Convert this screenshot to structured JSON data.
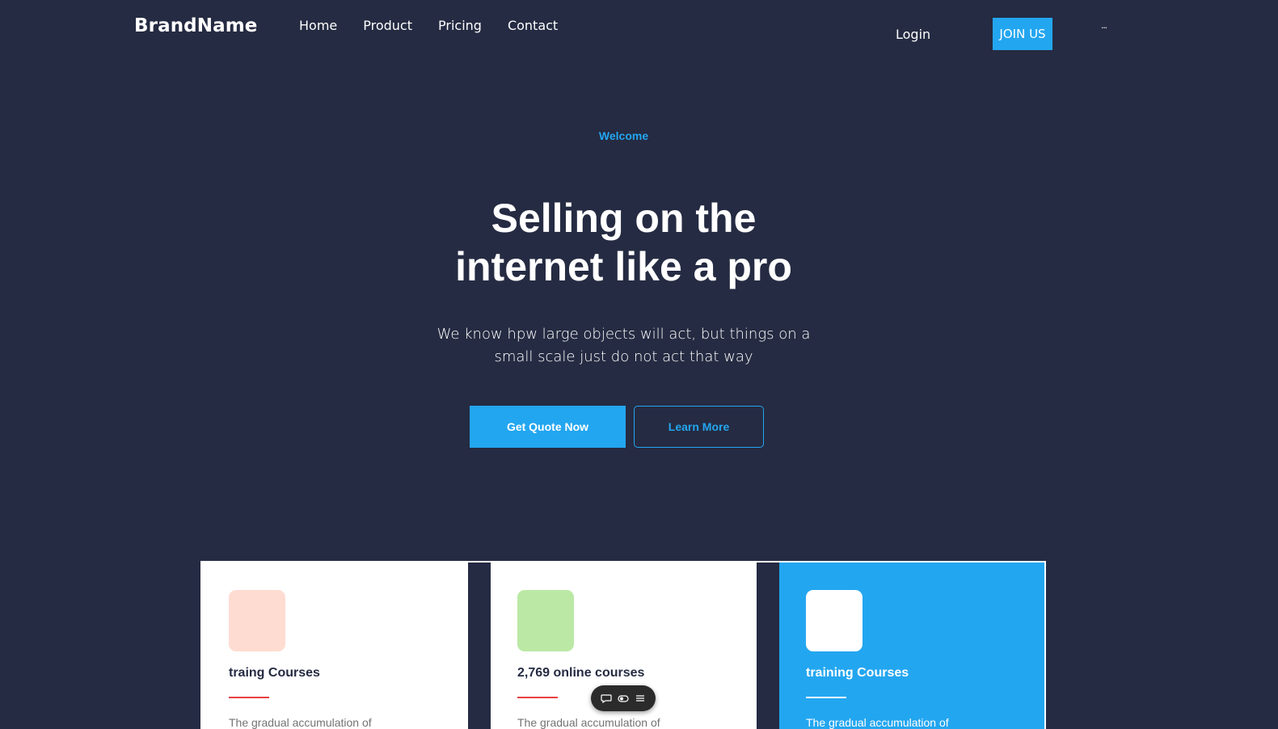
{
  "nav": {
    "brand": "BrandName",
    "links": [
      "Home",
      "Product",
      "Pricing",
      "Contact"
    ],
    "login": "Login",
    "join": "JOIN US",
    "more": "..."
  },
  "hero": {
    "welcome": "Welcome",
    "title_lines": [
      "Selling on the",
      "internet like a pro"
    ],
    "desc_lines": [
      "We know hpw large objects will act, but things on a",
      "small scale just do not act that way"
    ],
    "primary_button": "Get Quote Now",
    "secondary_button": "Learn More"
  },
  "cards": [
    {
      "title": "traing Courses",
      "text": "The gradual accumulation of",
      "icon_color": "#ffdcd1"
    },
    {
      "title": "2,769 online courses",
      "text": "The gradual accumulation of",
      "icon_color": "#bbe9a5"
    },
    {
      "title": "training Courses",
      "text": "The gradual accumulation of",
      "icon_color": "#ffffff"
    }
  ],
  "toolbar": {
    "icons": [
      "comment-icon",
      "toggle-icon",
      "menu-icon"
    ]
  },
  "colors": {
    "background": "#252b42",
    "accent": "#23a6f0",
    "danger": "#e74040"
  }
}
